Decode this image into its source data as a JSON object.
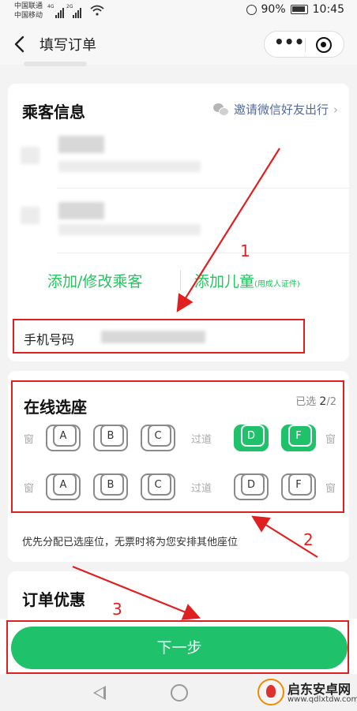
{
  "status_bar": {
    "carrier_1": "中国联通",
    "carrier_2": "中国移动",
    "net_1": "4G",
    "net_2": "2G",
    "battery": "90%",
    "time": "10:45"
  },
  "nav": {
    "title": "填写订单",
    "more_glyph": "•••"
  },
  "passenger": {
    "title": "乘客信息",
    "invite_label": "邀请微信好友出行",
    "invite_chevron": "›",
    "add_passenger": "添加/修改乘客",
    "add_child": "添加儿童",
    "add_child_note": "(用成人证件)",
    "phone_label": "手机号码"
  },
  "seat": {
    "title": "在线选座",
    "selected_prefix": "已选",
    "selected_count": "2",
    "selected_total": "/2",
    "window": "窗",
    "aisle": "过道",
    "rows": [
      {
        "seats": [
          {
            "letter": "A",
            "selected": false
          },
          {
            "letter": "B",
            "selected": false
          },
          {
            "letter": "C",
            "selected": false
          },
          {
            "letter": "D",
            "selected": true
          },
          {
            "letter": "F",
            "selected": true
          }
        ]
      },
      {
        "seats": [
          {
            "letter": "A",
            "selected": false
          },
          {
            "letter": "B",
            "selected": false
          },
          {
            "letter": "C",
            "selected": false
          },
          {
            "letter": "D",
            "selected": false
          },
          {
            "letter": "F",
            "selected": false
          }
        ]
      }
    ],
    "note": "优先分配已选座位，无票时将为您安排其他座位"
  },
  "offer": {
    "title": "订单优惠"
  },
  "footer": {
    "next_label": "下一步"
  },
  "annotations": {
    "step_1": "1",
    "step_2": "2",
    "step_3": "3",
    "color": "#e02020"
  },
  "watermark": {
    "title": "启东安卓网",
    "url": "www.qdlxtdw.com"
  },
  "colors": {
    "accent": "#1fc16b",
    "link": "#576b95",
    "highlight": "#e02020"
  }
}
